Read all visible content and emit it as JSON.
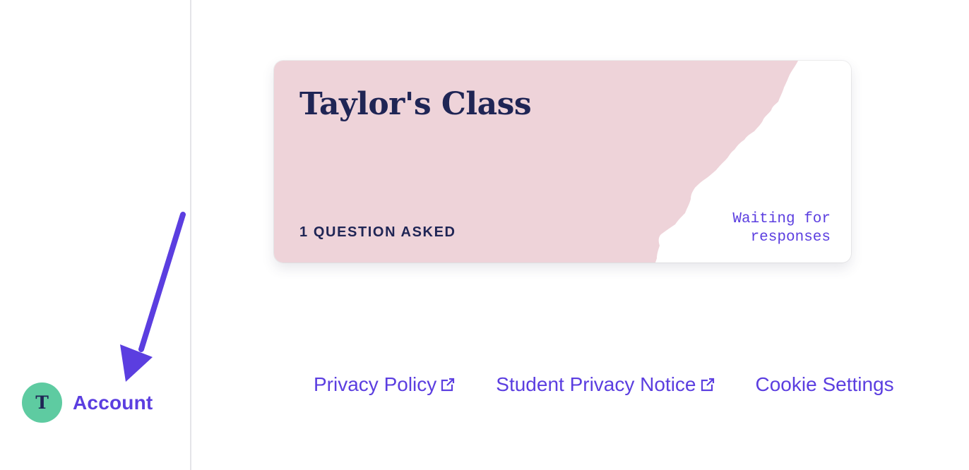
{
  "sidebar": {
    "account": {
      "avatar_initial": "T",
      "label": "Account"
    }
  },
  "card": {
    "title": "Taylor's Class",
    "questions_count": "1 QUESTION ASKED",
    "status_line1": "Waiting for",
    "status_line2": "responses",
    "colors": {
      "background": "#eed3d9",
      "text": "#1f2555",
      "status": "#5b3ee0"
    }
  },
  "footer": {
    "privacy_policy": "Privacy Policy",
    "student_privacy_notice": "Student Privacy Notice",
    "cookie_settings": "Cookie Settings"
  },
  "icons": {
    "account_avatar": "avatar",
    "external_link": "external-link-icon",
    "annotation_arrow": "arrow-icon"
  },
  "colors": {
    "accent": "#5b3ee0",
    "avatar_bg": "#5ecba1",
    "divider": "#e4e4e8"
  }
}
